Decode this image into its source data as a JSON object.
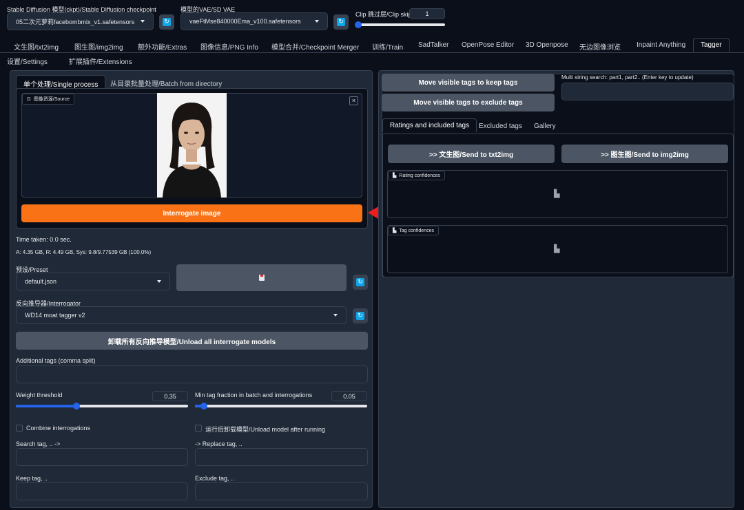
{
  "top": {
    "checkpoint_label": "Stable Diffusion 模型(ckpt)/Stable Diffusion checkpoint",
    "checkpoint_value": "05二次元萝莉facebombmix_v1.safetensors [aa",
    "vae_label": "模型的VAE/SD VAE",
    "vae_value": "vaeFtMse840000Ema_v100.safetensors",
    "clip_label": "Clip 跳过层/Clip skip",
    "clip_value": "1"
  },
  "tabs": [
    "文生图/txt2img",
    "图生图/img2img",
    "额外功能/Extras",
    "图像信息/PNG Info",
    "模型合并/Checkpoint Merger",
    "训练/Train",
    "SadTalker",
    "OpenPose Editor",
    "3D Openpose",
    "无边图像浏览",
    "Inpaint Anything",
    "Tagger"
  ],
  "tabs2": [
    "设置/Settings",
    "扩展插件/Extensions"
  ],
  "left": {
    "subtab_single": "单个处理/Single process",
    "subtab_batch": "从目录批量处理/Batch from directory",
    "source_label": "图像资源/Source",
    "interrogate_label": "Interrogate image",
    "time_taken": "Time taken: 0.0 sec.",
    "memory": "A: 4.35 GB, R: 4.49 GB, Sys: 9.8/9.77539 GB (100.0%)",
    "preset_label": "预设/Preset",
    "preset_value": "default.json",
    "interrogator_label": "反向推导器/Interrogator",
    "interrogator_value": "WD14 moat tagger v2",
    "unload_all_label": "卸载所有反向推导模型/Unload all interrogate models",
    "additional_tags_label": "Additional tags (comma split)",
    "weight_label": "Weight threshold",
    "weight_value": "0.35",
    "weight_fraction": 0.35,
    "mintag_label": "Min tag fraction in batch and interrogations",
    "mintag_value": "0.05",
    "mintag_fraction": 0.05,
    "combine_label": "Combine interrogations",
    "unload_after_label": "运行后卸载模型/Unload model after running",
    "search_tag_label": "Search tag, .. ->",
    "replace_tag_label": "-> Replace tag, ..",
    "keep_tag_label": "Keep tag, ..",
    "exclude_tag_label": "Exclude tag, .."
  },
  "right": {
    "keep_btn": "Move visible tags to keep tags",
    "exclude_btn": "Move visible tags to exclude tags",
    "multi_search_label": "Multi string search: part1, part2.. (Enter key to update)",
    "tab_ratings": "Ratings and included tags",
    "tab_excluded": "Excluded tags",
    "tab_gallery": "Gallery",
    "send_txt2img": ">> 文生图/Send to txt2img",
    "send_img2img": ">> 图生图/Send to img2img",
    "rating_label": "Rating confidences",
    "tag_label": "Tag confidences"
  },
  "colors": {
    "accent_orange": "#f97316",
    "annotation_red": "#ee1c1c",
    "slider_blue": "#2563eb",
    "refresh_blue": "#0ea5e9"
  }
}
